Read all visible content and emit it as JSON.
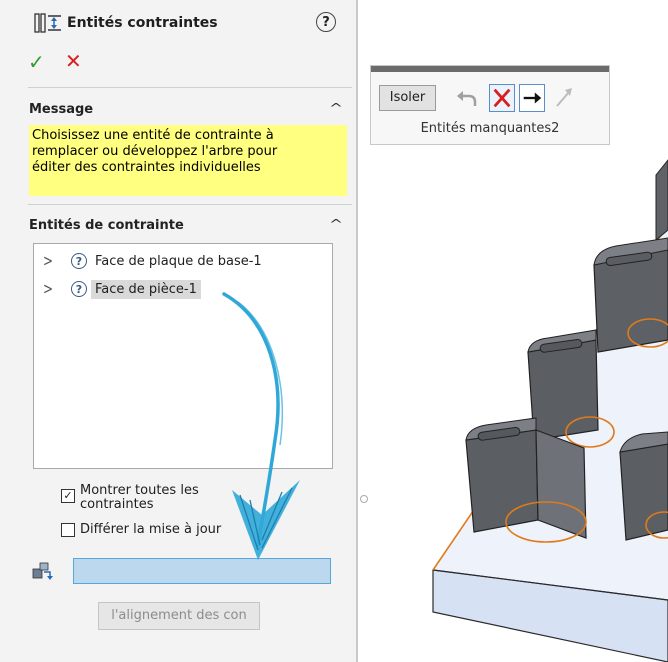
{
  "panel": {
    "title": "Entités contraintes",
    "help_icon": "question-icon",
    "help_label": "?",
    "ok_icon": "checkmark-icon",
    "ok_label": "✓",
    "cancel_icon": "close-icon",
    "cancel_label": "✕"
  },
  "message_section": {
    "title": "Message",
    "lines": [
      "Choisissez une entité de contrainte à",
      "remplacer ou développez l'arbre pour",
      "éditer des contraintes individuelles"
    ]
  },
  "entities_section": {
    "title": "Entités de contrainte",
    "items": [
      {
        "label": "Face de plaque de base-1",
        "selected": false
      },
      {
        "label": "Face de pièce-1",
        "selected": true
      }
    ]
  },
  "options": {
    "show_all_line1": "Montrer toutes les",
    "show_all_line2": "contraintes",
    "show_all_checked": true,
    "defer_update": "Différer la mise à jour",
    "defer_checked": false
  },
  "selection_field": {
    "value": ""
  },
  "align_button": {
    "label": "l'alignement des con"
  },
  "toolbar": {
    "isolate_label": "Isoler",
    "label": "Entités manquantes2",
    "icons": [
      "undo-icon",
      "delete-icon",
      "next-arrow-icon",
      "disabled-arrow-icon"
    ]
  },
  "colors": {
    "accent_blue": "#2fa8d8",
    "message_bg": "#ffff80",
    "highlight_orange": "#e07b1a"
  }
}
